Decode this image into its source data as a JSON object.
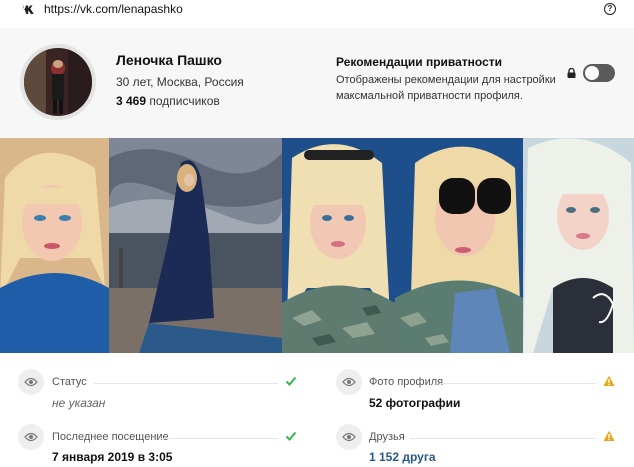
{
  "browser": {
    "url": "https://vk.com/lenapashko",
    "site_icon": "vk-logo-icon",
    "help_icon": "question-icon",
    "help_glyph": "?"
  },
  "profile": {
    "name": "Леночка Пашко",
    "details": "30 лет, Москва, Россия",
    "followers_count": "3 469",
    "followers_label": "подписчиков"
  },
  "privacy": {
    "title": "Рекомендации приватности",
    "description": "Отображены рекомендации для настройки максмальной приватности профиля.",
    "toggle_on": false
  },
  "photos": [
    {
      "name": "photo-1"
    },
    {
      "name": "photo-2"
    },
    {
      "name": "photo-3"
    },
    {
      "name": "photo-4"
    },
    {
      "name": "photo-5"
    }
  ],
  "info": {
    "status": {
      "label": "Статус",
      "value": "не указан",
      "state": "ok"
    },
    "last_seen": {
      "label": "Последнее посещение",
      "value": "7 января 2019 в 3:05",
      "state": "ok"
    },
    "profile_photos": {
      "label": "Фото профиля",
      "value": "52 фотографии",
      "state": "warning"
    },
    "friends": {
      "label": "Друзья",
      "value": "1 152 друга",
      "state": "warning"
    }
  },
  "colors": {
    "ok": "#3bb54a",
    "warning": "#e6a817",
    "link": "#2a5885"
  }
}
